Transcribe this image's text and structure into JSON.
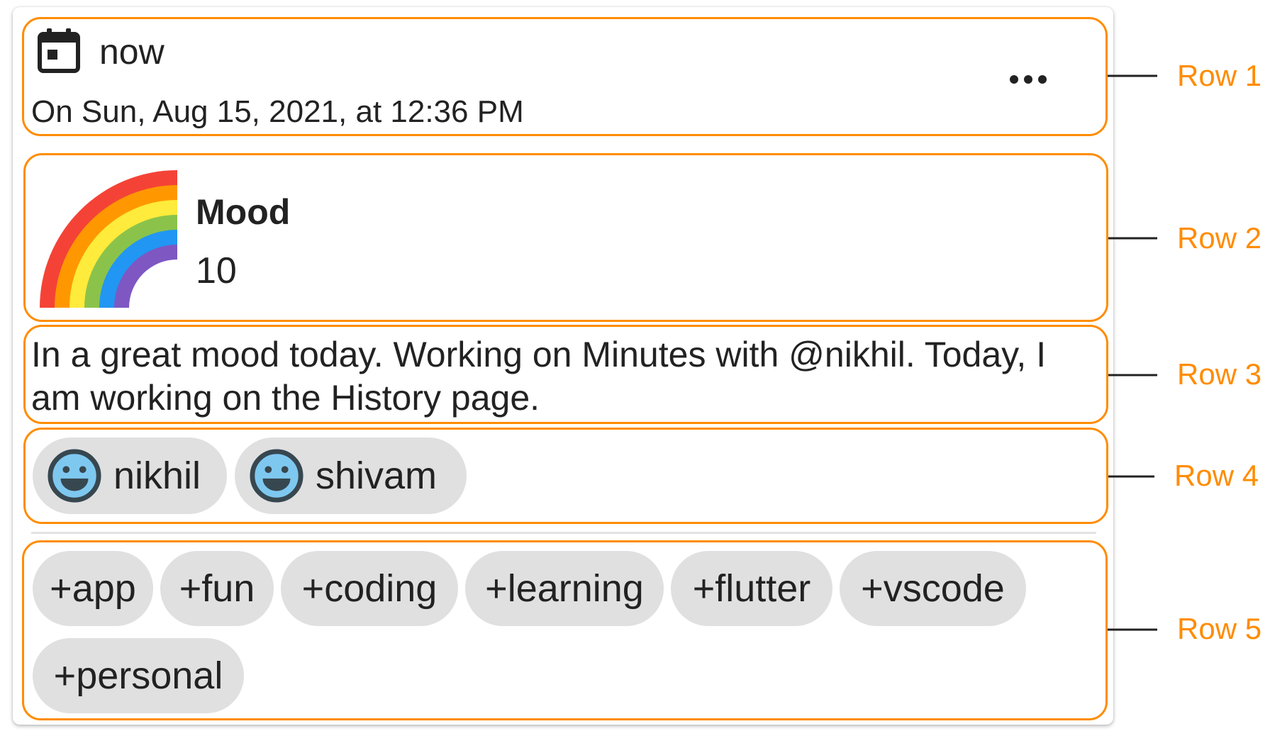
{
  "entry": {
    "time_relative": "now",
    "time_full": "On Sun, Aug 15, 2021, at 12:36 PM",
    "calendar_icon": "calendar-icon",
    "more_icon": "more-horizontal-icon",
    "mood": {
      "label": "Mood",
      "value": "10",
      "icon": "rainbow-icon"
    },
    "note": "In a great mood today. Working on Minutes with @nikhil. Today, I am working on the History page.",
    "people": [
      {
        "name": "nikhil",
        "icon": "smiley-face-icon"
      },
      {
        "name": "shivam",
        "icon": "smiley-face-icon"
      }
    ],
    "tags": [
      "+app",
      "+fun",
      "+coding",
      "+learning",
      "+flutter",
      "+vscode",
      "+personal"
    ]
  },
  "annotations": {
    "labels": [
      "Row 1",
      "Row 2",
      "Row 3",
      "Row 4",
      "Row 5"
    ],
    "color": "#ff8c00"
  },
  "colors": {
    "chip_background": "#e0e0e0",
    "text": "#222222",
    "face_fill": "#7ec8f0",
    "face_stroke": "#37474f"
  }
}
